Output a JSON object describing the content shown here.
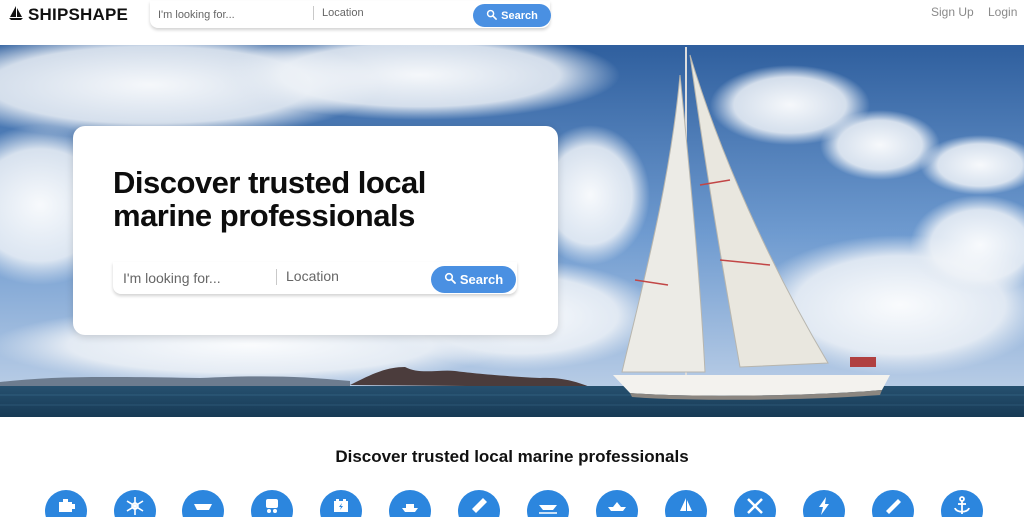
{
  "header": {
    "logo_text": "SHIPSHAPE",
    "logo_icon": "sailboat-icon",
    "search": {
      "what_placeholder": "I'm looking for...",
      "where_placeholder": "Location",
      "button_label": "Search"
    },
    "signup_label": "Sign Up",
    "login_label": "Login"
  },
  "hero": {
    "title": "Discover trusted local marine professionals",
    "search": {
      "what_placeholder": "I'm looking for...",
      "where_placeholder": "Location",
      "button_label": "Search"
    }
  },
  "section": {
    "title": "Discover trusted local marine professionals",
    "categories": [
      {
        "icon": "engine-icon"
      },
      {
        "icon": "snowflake-icon"
      },
      {
        "icon": "hull-icon"
      },
      {
        "icon": "trailer-icon"
      },
      {
        "icon": "battery-icon"
      },
      {
        "icon": "yacht-icon"
      },
      {
        "icon": "wrench-icon"
      },
      {
        "icon": "boat-bottom-icon"
      },
      {
        "icon": "speedboat-icon"
      },
      {
        "icon": "sail-icon"
      },
      {
        "icon": "tools-icon"
      },
      {
        "icon": "electric-icon"
      },
      {
        "icon": "ruler-icon"
      },
      {
        "icon": "anchor-icon"
      }
    ]
  },
  "colors": {
    "accent": "#4a90e2",
    "category_circle": "#2c86de"
  }
}
